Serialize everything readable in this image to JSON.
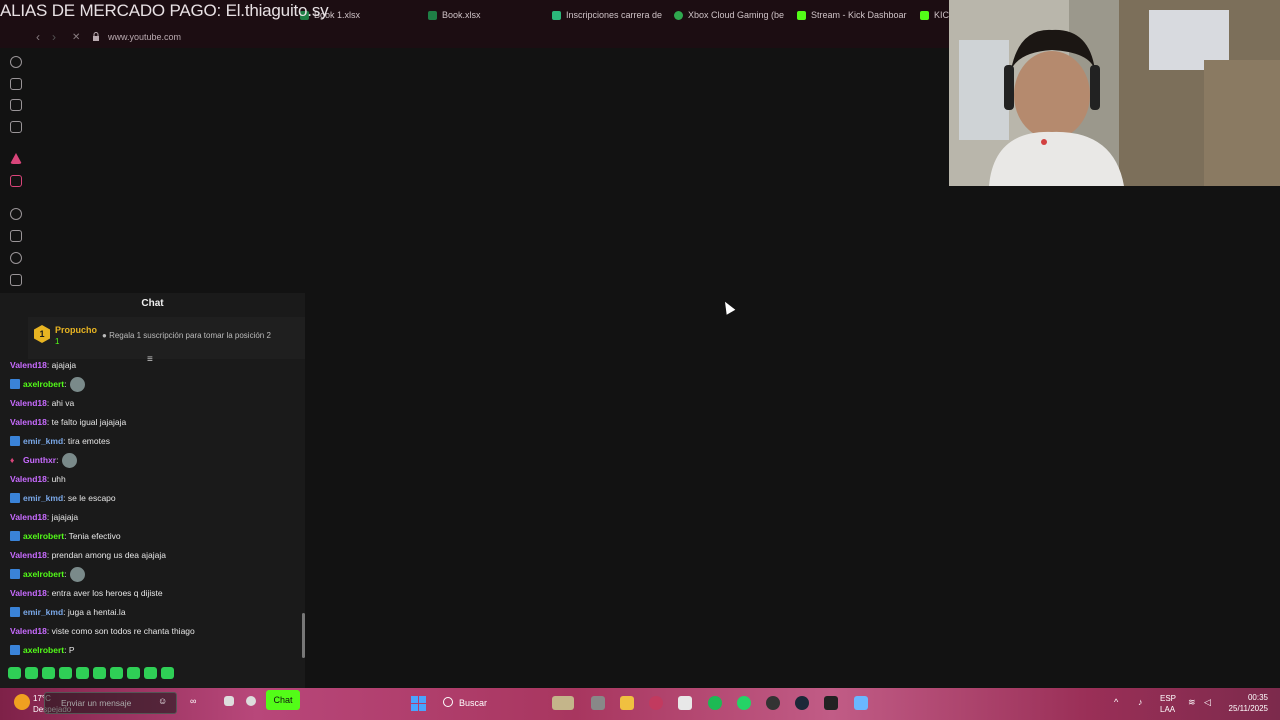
{
  "overlay": {
    "title": "ALIAS DE MERCADO PAGO: El.thiaguito.sy"
  },
  "tabs": [
    {
      "label": "Book 1.xlsx"
    },
    {
      "label": "Book.xlsx"
    },
    {
      "label": "Inscripciones carrera de"
    },
    {
      "label": "Xbox Cloud Gaming (be"
    },
    {
      "label": "Stream - Kick Dashboar"
    },
    {
      "label": "KIC"
    }
  ],
  "address": {
    "url": "www.youtube.com"
  },
  "chat": {
    "title": "Chat",
    "pinned": {
      "rank": "1",
      "user": "Propucho",
      "amount": "1",
      "message": "Regala 1 suscripción para tomar la posición 2"
    },
    "messages": [
      {
        "user": "Valend18",
        "sep": ": ",
        "text": "ajajaja",
        "color": "#c86bff",
        "badge": false
      },
      {
        "user": "axelrobert",
        "sep": ": ",
        "text": "",
        "color": "#53fc18",
        "badge": true,
        "emote": true
      },
      {
        "user": "Valend18",
        "sep": ": ",
        "text": "ahi va",
        "color": "#c86bff",
        "badge": false
      },
      {
        "user": "Valend18",
        "sep": ": ",
        "text": "te falto igual jajajaja",
        "color": "#c86bff",
        "badge": false
      },
      {
        "user": "emir_kmd",
        "sep": ": ",
        "text": "tira emotes",
        "color": "#7aa8e8",
        "badge": true
      },
      {
        "user": "Gunthxr",
        "sep": ": ",
        "text": "",
        "color": "#c86bff",
        "badge": "mic",
        "emote": true
      },
      {
        "user": "Valend18",
        "sep": ": ",
        "text": "uhh",
        "color": "#c86bff",
        "badge": false
      },
      {
        "user": "emir_kmd",
        "sep": ": ",
        "text": "se le escapo",
        "color": "#7aa8e8",
        "badge": true
      },
      {
        "user": "Valend18",
        "sep": ": ",
        "text": "jajajaja",
        "color": "#c86bff",
        "badge": false
      },
      {
        "user": "axelrobert",
        "sep": ": ",
        "text": "Tenia efectivo",
        "color": "#53fc18",
        "badge": true
      },
      {
        "user": "Valend18",
        "sep": ": ",
        "text": "prendan among us dea ajajaja",
        "color": "#c86bff",
        "badge": false
      },
      {
        "user": "axelrobert",
        "sep": ": ",
        "text": "",
        "color": "#53fc18",
        "badge": true,
        "emote": true
      },
      {
        "user": "Valend18",
        "sep": ": ",
        "text": "entra aver los heroes q dijiste",
        "color": "#c86bff",
        "badge": false
      },
      {
        "user": "emir_kmd",
        "sep": ": ",
        "text": "juga a hentai.la",
        "color": "#7aa8e8",
        "badge": true
      },
      {
        "user": "Valend18",
        "sep": ": ",
        "text": "viste como son todos re chanta thiago",
        "color": "#c86bff",
        "badge": false
      },
      {
        "user": "axelrobert",
        "sep": ": ",
        "text": "P",
        "color": "#53fc18",
        "badge": true
      }
    ],
    "input_placeholder": "Enviar un mensaje",
    "send_label": "Chat"
  },
  "taskbar": {
    "weather_temp": "17°C",
    "weather_desc": "Despejado",
    "search_label": "Buscar",
    "lang_top": "ESP",
    "lang_bottom": "LAA",
    "time": "00:35",
    "date": "25/11/2025"
  },
  "colors": {
    "kick_green": "#53fc18",
    "taskbar_pink": "#b8477a",
    "chat_bg": "#1a1a1a"
  }
}
